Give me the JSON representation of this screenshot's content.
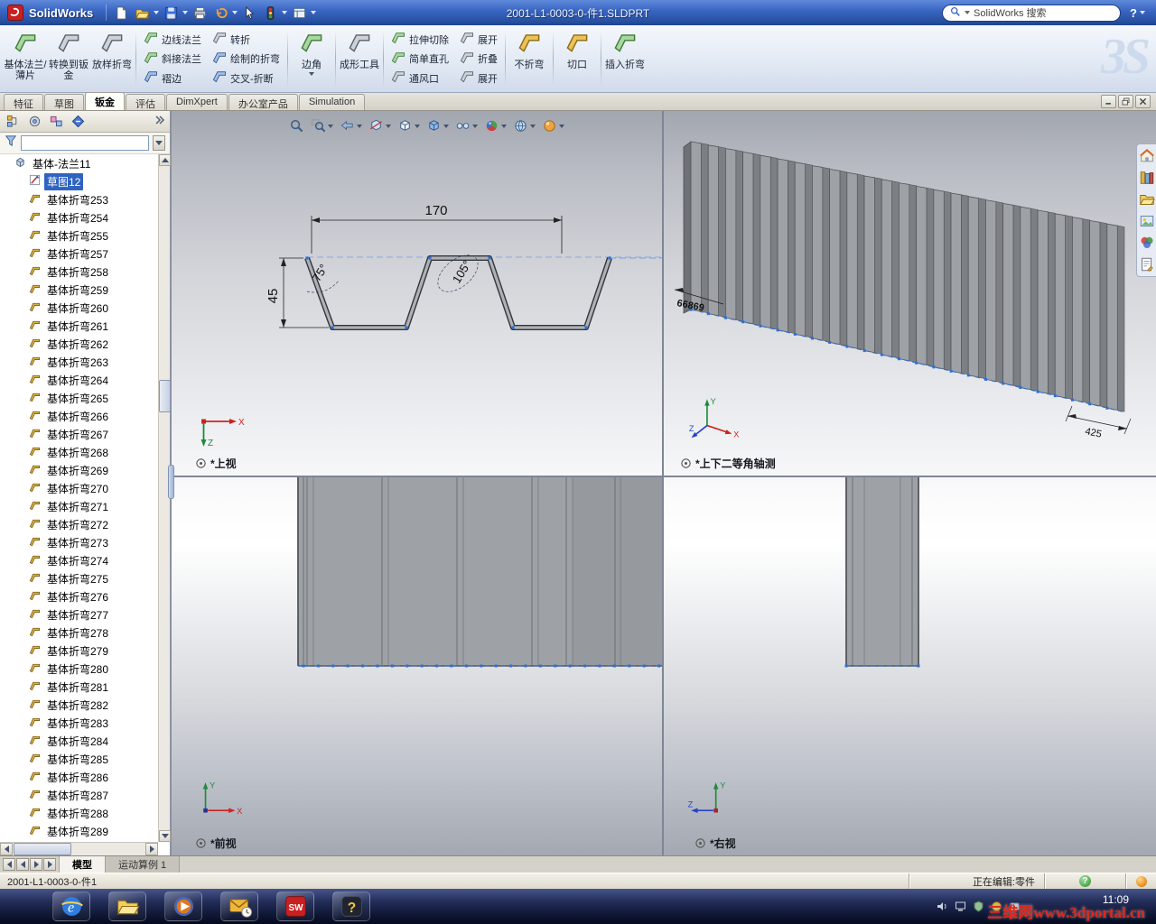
{
  "titlebar": {
    "app_name": "SolidWorks",
    "document_title": "2001-L1-0003-0-件1.SLDPRT",
    "search_value": "SolidWorks 搜索",
    "help_glyph": "?",
    "toolbar_icons": [
      "new-document",
      "open",
      "save",
      "print",
      "undo",
      "select",
      "selection-filter",
      "view-list"
    ]
  },
  "branding": {
    "ds_watermark": "3S"
  },
  "ribbon": {
    "columns": [
      {
        "type": "large",
        "buttons": [
          {
            "icon": "base-flange",
            "label": "基体法兰/薄片"
          }
        ]
      },
      {
        "type": "large",
        "buttons": [
          {
            "icon": "convert-to-sheet-metal",
            "label": "转换到钣金"
          }
        ]
      },
      {
        "type": "large",
        "buttons": [
          {
            "icon": "lofted-bend",
            "label": "放样折弯"
          }
        ]
      },
      {
        "type": "stack",
        "buttons": [
          {
            "icon": "edge-flange",
            "label": "边线法兰"
          },
          {
            "icon": "miter-flange",
            "label": "斜接法兰"
          },
          {
            "icon": "hem",
            "label": "褶边"
          }
        ]
      },
      {
        "type": "stack",
        "buttons": [
          {
            "icon": "jog",
            "label": "转折"
          },
          {
            "icon": "sketched-bend",
            "label": "绘制的折弯"
          },
          {
            "icon": "cross-break",
            "label": "交叉-折断"
          }
        ]
      },
      {
        "type": "large",
        "dropdown": true,
        "buttons": [
          {
            "icon": "corner",
            "label": "边角"
          }
        ]
      },
      {
        "type": "large",
        "buttons": [
          {
            "icon": "forming-tool",
            "label": "成形工具"
          }
        ]
      },
      {
        "type": "stack",
        "buttons": [
          {
            "icon": "extruded-cut",
            "label": "拉伸切除"
          },
          {
            "icon": "simple-hole",
            "label": "简单直孔"
          },
          {
            "icon": "vent",
            "label": "通风口"
          }
        ]
      },
      {
        "type": "stack",
        "buttons": [
          {
            "icon": "unfold",
            "label": "展开"
          },
          {
            "icon": "fold",
            "label": "折叠"
          },
          {
            "icon": "flatten",
            "label": "展开"
          }
        ]
      },
      {
        "type": "large",
        "buttons": [
          {
            "icon": "no-bends",
            "label": "不折弯"
          }
        ]
      },
      {
        "type": "large",
        "buttons": [
          {
            "icon": "rip",
            "label": "切口"
          }
        ]
      },
      {
        "type": "large",
        "buttons": [
          {
            "icon": "insert-bends",
            "label": "插入折弯"
          }
        ]
      }
    ],
    "separators_after": [
      2,
      4,
      5,
      6,
      8,
      9,
      10
    ]
  },
  "command_tabs": [
    {
      "label": "特征",
      "active": false
    },
    {
      "label": "草图",
      "active": false
    },
    {
      "label": "钣金",
      "active": true
    },
    {
      "label": "评估",
      "active": false
    },
    {
      "label": "DimXpert",
      "active": false
    },
    {
      "label": "办公室产品",
      "active": false
    },
    {
      "label": "Simulation",
      "active": false
    }
  ],
  "left_panel": {
    "tab_icons": [
      "feature-manager",
      "property-manager",
      "configuration-manager",
      "dimxpert-manager"
    ]
  },
  "feature_tree": {
    "root": "基体-法兰11",
    "selected": "草图12",
    "children": [
      "草图12",
      "基体折弯253",
      "基体折弯254",
      "基体折弯255",
      "基体折弯257",
      "基体折弯258",
      "基体折弯259",
      "基体折弯260",
      "基体折弯261",
      "基体折弯262",
      "基体折弯263",
      "基体折弯264",
      "基体折弯265",
      "基体折弯266",
      "基体折弯267",
      "基体折弯268",
      "基体折弯269",
      "基体折弯270",
      "基体折弯271",
      "基体折弯272",
      "基体折弯273",
      "基体折弯274",
      "基体折弯275",
      "基体折弯276",
      "基体折弯277",
      "基体折弯278",
      "基体折弯279",
      "基体折弯280",
      "基体折弯281",
      "基体折弯282",
      "基体折弯283",
      "基体折弯284",
      "基体折弯285",
      "基体折弯286",
      "基体折弯287",
      "基体折弯288",
      "基体折弯289"
    ]
  },
  "viewport": {
    "headsup_icons": [
      "zoom-fit",
      "zoom-area",
      "zoom-previous",
      "section-view",
      "view-orientation",
      "display-style",
      "hide-show-items",
      "edit-appearance",
      "apply-scene",
      "view-settings"
    ],
    "task_pane_icons": [
      "home",
      "design-library",
      "file-explorer",
      "view-palette",
      "appearances",
      "custom-properties"
    ],
    "triad_labels": {
      "x": "X",
      "y": "Y",
      "z": "Z"
    },
    "views": {
      "top": {
        "label": "*上视",
        "dims": {
          "width": "170",
          "height": "45",
          "angle_left": "75°",
          "angle_right": "105°"
        }
      },
      "iso": {
        "label": "*上下二等角轴测",
        "dims": {
          "length": "66869",
          "depth": "425"
        }
      },
      "front": {
        "label": "*前视"
      },
      "right": {
        "label": "*右视"
      }
    }
  },
  "doc_tabs": [
    {
      "label": "模型",
      "active": true
    },
    {
      "label": "运动算例 1",
      "active": false
    }
  ],
  "statusbar": {
    "document": "2001-L1-0003-0-件1",
    "editing": "正在编辑:零件",
    "help_glyph": "?"
  },
  "taskbar": {
    "quick_launch": [
      "internet-explorer",
      "file-explorer",
      "media-player",
      "outlook",
      "solidworks",
      "help"
    ],
    "time": "11:09",
    "watermark": "三维网www.3dportal.cn"
  },
  "colors": {
    "selection_blue": "#2f63c0",
    "sketch_dash_blue": "#88abde",
    "model_gray": "#9ea1a6",
    "titlebar_blue": "#3b67c4",
    "taskbar_navy": "#0c1430"
  }
}
